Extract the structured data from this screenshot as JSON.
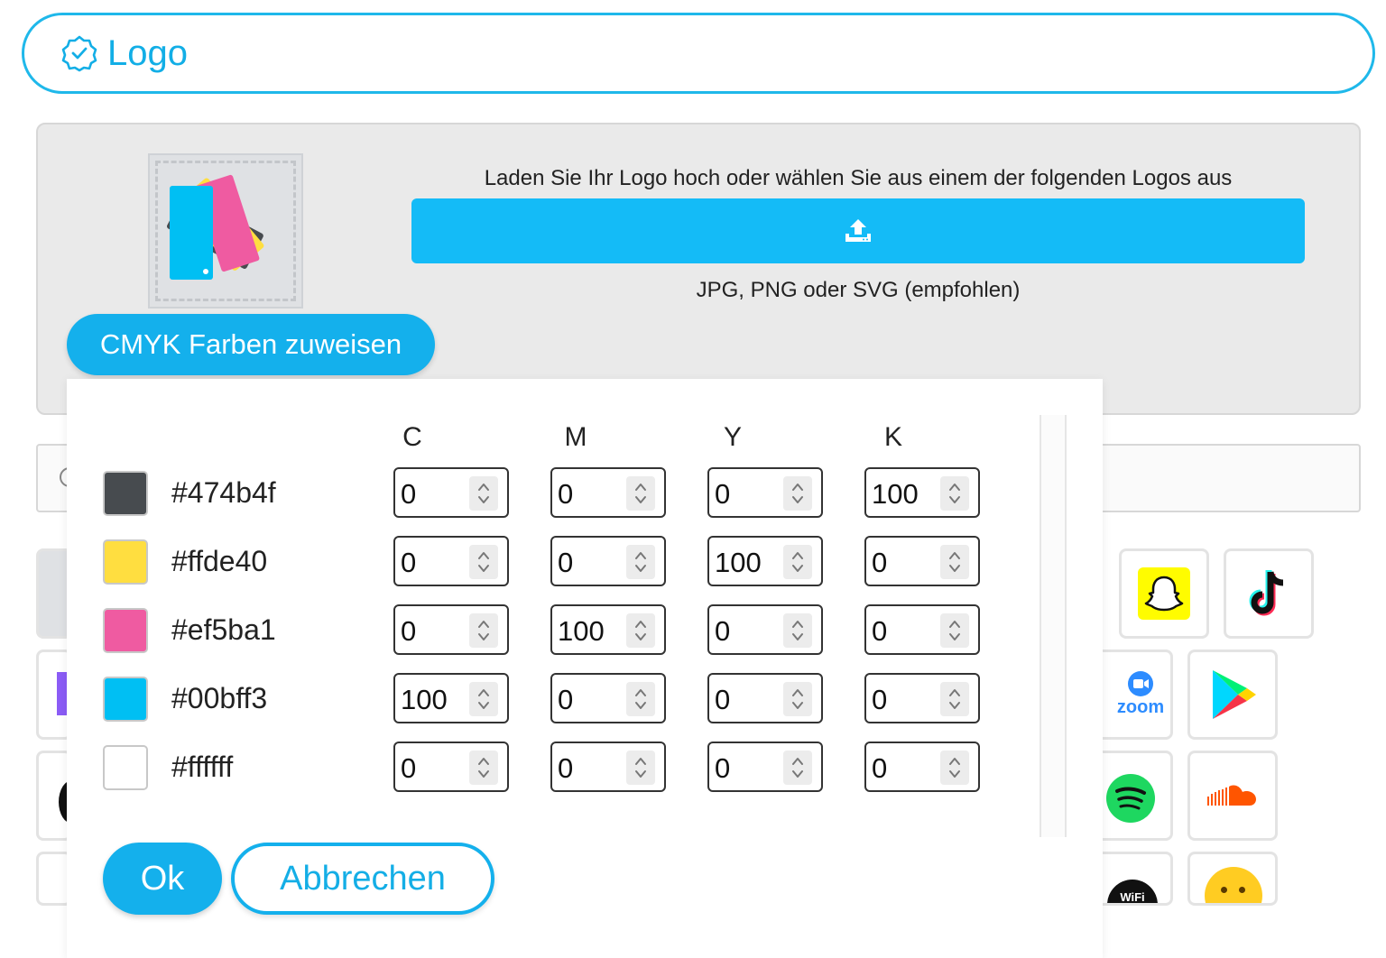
{
  "header": {
    "title": "Logo",
    "icon": "verified-badge-icon"
  },
  "upload": {
    "instruction": "Laden Sie Ihr Logo hoch oder wählen Sie aus einem der folgenden Logos aus",
    "button_icon": "upload-icon",
    "hint": "JPG, PNG oder SVG (empfohlen)",
    "button_color": "#14bbf7"
  },
  "cmyk_button": {
    "label": "CMYK Farben zuweisen"
  },
  "background_logos": [
    "snapchat-icon",
    "tiktok-icon",
    "zoom-icon",
    "google-play-icon",
    "spotify-icon",
    "soundcloud-icon",
    "wifi-icon",
    "emoji-icon"
  ],
  "background_texts": {
    "zoom": "zoom",
    "wifi": "WiFi"
  },
  "modal": {
    "columns": [
      "C",
      "M",
      "Y",
      "K"
    ],
    "rows": [
      {
        "hex": "#474b4f",
        "color": "#474b4f",
        "values": [
          "0",
          "0",
          "0",
          "100"
        ]
      },
      {
        "hex": "#ffde40",
        "color": "#ffde40",
        "values": [
          "0",
          "0",
          "100",
          "0"
        ]
      },
      {
        "hex": "#ef5ba1",
        "color": "#ef5ba1",
        "values": [
          "0",
          "100",
          "0",
          "0"
        ]
      },
      {
        "hex": "#00bff3",
        "color": "#00bff3",
        "values": [
          "100",
          "0",
          "0",
          "0"
        ]
      },
      {
        "hex": "#ffffff",
        "color": "#ffffff",
        "values": [
          "0",
          "0",
          "0",
          "0"
        ]
      }
    ],
    "ok_label": "Ok",
    "cancel_label": "Abbrechen",
    "accent": "#14b0ec"
  }
}
